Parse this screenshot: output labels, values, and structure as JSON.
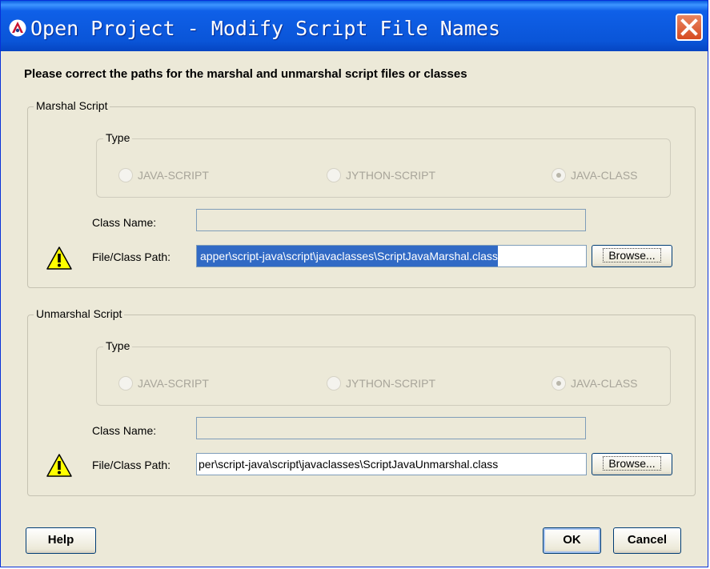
{
  "window": {
    "title": "Open Project - Modify Script File Names",
    "app_icon": "app-logo-icon",
    "close_icon": "close-icon"
  },
  "instruction": "Please correct the paths for the marshal and unmarshal script files or classes",
  "marshal": {
    "group_label": "Marshal Script",
    "type_label": "Type",
    "radios": [
      {
        "label": "JAVA-SCRIPT",
        "checked": false
      },
      {
        "label": "JYTHON-SCRIPT",
        "checked": false
      },
      {
        "label": "JAVA-CLASS",
        "checked": true
      }
    ],
    "class_name_label": "Class Name:",
    "class_name_value": "",
    "path_label": "File/Class Path:",
    "path_value": "apper\\script-java\\script\\javaclasses\\ScriptJavaMarshal.class",
    "browse_label": "Browse...",
    "warning_icon": "warning-icon"
  },
  "unmarshal": {
    "group_label": "Unmarshal Script",
    "type_label": "Type",
    "radios": [
      {
        "label": "JAVA-SCRIPT",
        "checked": false
      },
      {
        "label": "JYTHON-SCRIPT",
        "checked": false
      },
      {
        "label": "JAVA-CLASS",
        "checked": true
      }
    ],
    "class_name_label": "Class Name:",
    "class_name_value": "",
    "path_label": "File/Class Path:",
    "path_value": "per\\script-java\\script\\javaclasses\\ScriptJavaUnmarshal.class",
    "browse_label": "Browse...",
    "warning_icon": "warning-icon"
  },
  "footer": {
    "help_label": "Help",
    "ok_label": "OK",
    "cancel_label": "Cancel"
  },
  "colors": {
    "titlebar": "#0a55d8",
    "selection": "#316ac5",
    "dialog_bg": "#ece9d8"
  }
}
